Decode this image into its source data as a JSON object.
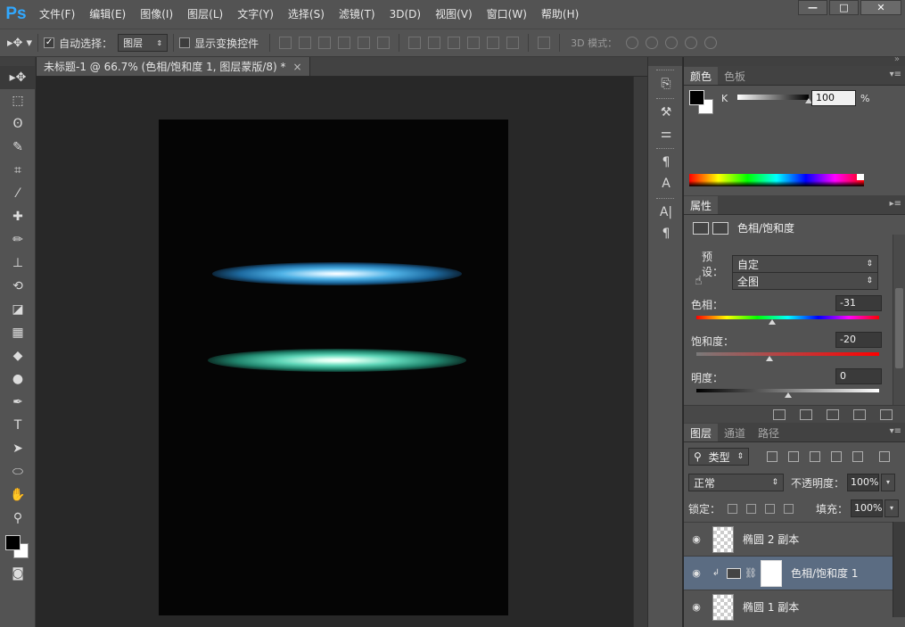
{
  "app": {
    "logo": "Ps"
  },
  "menu": [
    "文件(F)",
    "编辑(E)",
    "图像(I)",
    "图层(L)",
    "文字(Y)",
    "选择(S)",
    "滤镜(T)",
    "3D(D)",
    "视图(V)",
    "窗口(W)",
    "帮助(H)"
  ],
  "window_controls": {
    "minimize": "—",
    "maximize": "□",
    "close": "✕"
  },
  "options": {
    "auto_select_label": "自动选择：",
    "auto_select_checked": true,
    "auto_select_target": "图层",
    "show_transform_label": "显示变换控件",
    "mode_3d_label": "3D 模式："
  },
  "document": {
    "tab_title": "未标题-1 @ 66.7% (色相/饱和度 1, 图层蒙版/8) *",
    "close": "×"
  },
  "color_panel": {
    "tabs": [
      "颜色",
      "色板"
    ],
    "channel_label": "K",
    "channel_value": "100",
    "unit": "%",
    "slider_level": 1.0
  },
  "properties_panel": {
    "tab": "属性",
    "title": "色相/饱和度",
    "preset_label": "预设：",
    "preset_value": "自定",
    "range_value": "全图",
    "hue_label": "色相：",
    "hue_value": "-31",
    "saturation_label": "饱和度：",
    "saturation_value": "-20",
    "lightness_label": "明度：",
    "lightness_value": "0"
  },
  "layers_panel": {
    "tabs": [
      "图层",
      "通道",
      "路径"
    ],
    "filter_kind": "类型",
    "blend_mode": "正常",
    "opacity_label": "不透明度：",
    "opacity_value": "100%",
    "lock_label": "锁定：",
    "fill_label": "填充：",
    "fill_value": "100%",
    "layers": [
      {
        "name": "椭圆 2 副本",
        "selected": false
      },
      {
        "name": "色相/饱和度 1",
        "selected": true
      },
      {
        "name": "椭圆 1 副本",
        "selected": false
      }
    ]
  },
  "colors": {
    "app_bg": "#535353",
    "canvas_bg": "#050505",
    "glow_blue": "#4fb2e6",
    "glow_teal": "#5fd6b8",
    "selected_layer": "#5b6c82",
    "logo": "#31a8ff"
  }
}
